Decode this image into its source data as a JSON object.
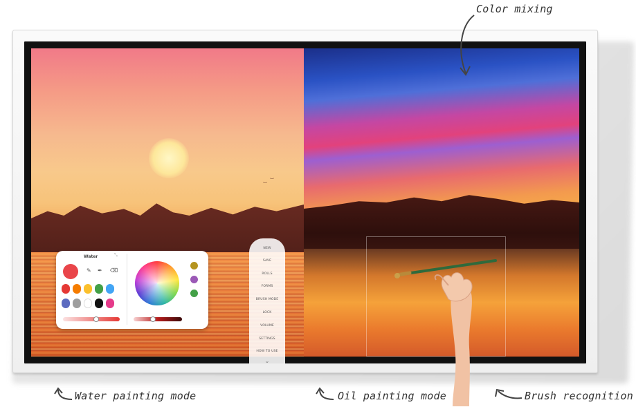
{
  "annotations": {
    "color_mixing": "Color mixing",
    "water_mode": "Water painting mode",
    "oil_mode": "Oil painting mode",
    "brush_recognition": "Brush recognition"
  },
  "palette": {
    "title": "Water",
    "swatches_row1": [
      "#e53935",
      "#f57c00",
      "#fbc02d",
      "#43a047",
      "#42a5f5"
    ],
    "swatches_row2": [
      "#5c6bc0",
      "#9e9e9e",
      "#ffffff",
      "#111111",
      "#e53a8a"
    ],
    "side_swatches": [
      "#b5941f",
      "#9b59b6",
      "#43a047"
    ],
    "brush_color": "#e9454a"
  },
  "menu": {
    "items": [
      "NEW",
      "SAVE",
      "ROLLS",
      "FORMS",
      "BRUSH MODE",
      "LOCK",
      "VOLUME",
      "SETTINGS",
      "HOW TO USE"
    ]
  }
}
